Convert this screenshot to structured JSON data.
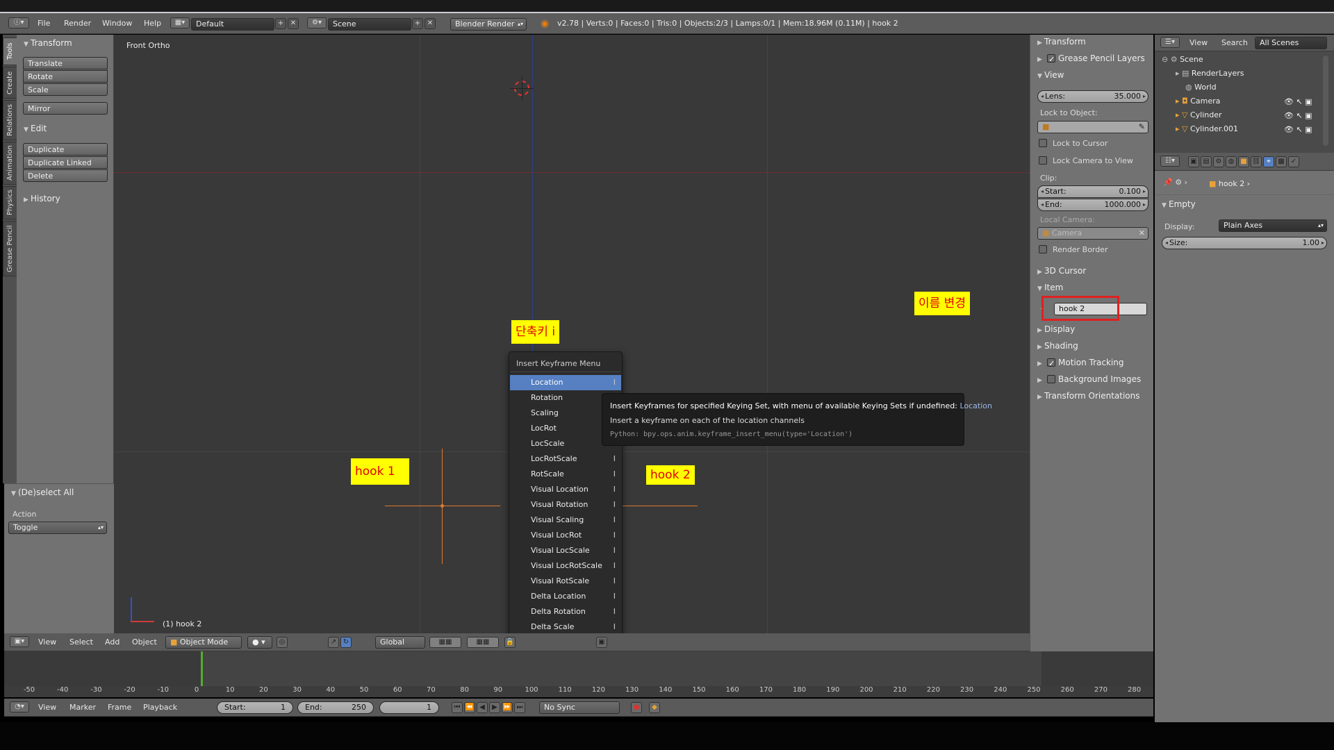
{
  "colors": {
    "accent_blue": "#5680c2",
    "annotation_bg": "#ffff00",
    "annotation_text": "#e00000",
    "viewport_bg": "#393939",
    "panel_bg": "#727272",
    "selection_orange": "#e07a30"
  },
  "top": {
    "menus": [
      "File",
      "Render",
      "Window",
      "Help"
    ],
    "layout": "Default",
    "scene": "Scene",
    "engine": "Blender Render",
    "stats": "v2.78 | Verts:0 | Faces:0 | Tris:0 | Objects:2/3 | Lamps:0/1 | Mem:18.96M (0.11M) | hook 2"
  },
  "tool_tabs": [
    "Tools",
    "Create",
    "Relations",
    "Animation",
    "Physics",
    "Grease Pencil"
  ],
  "toolshelf": {
    "transform_title": "Transform",
    "transform_buttons": [
      "Translate",
      "Rotate",
      "Scale"
    ],
    "mirror": "Mirror",
    "edit_title": "Edit",
    "edit_buttons": [
      "Duplicate",
      "Duplicate Linked",
      "Delete"
    ],
    "history": "History",
    "operator_title": "(De)select All",
    "action_label": "Action",
    "action_value": "Toggle"
  },
  "viewport": {
    "view_name": "Front Ortho",
    "object_label": "(1) hook 2",
    "annotations": {
      "shortcut": "단축키 i",
      "hook1": "hook 1",
      "hook2": "hook 2",
      "rename": "이름 변경"
    }
  },
  "keyframe_menu": {
    "title": "Insert Keyframe Menu",
    "items": [
      "Location",
      "Rotation",
      "Scaling",
      "LocRot",
      "LocScale",
      "LocRotScale",
      "RotScale",
      "Visual Location",
      "Visual Rotation",
      "Visual Scaling",
      "Visual LocRot",
      "Visual LocScale",
      "Visual LocRotScale",
      "Visual RotScale",
      "Delta Location",
      "Delta Rotation",
      "Delta Scale"
    ],
    "shortcut": "I",
    "tooltip": {
      "line1": "Insert Keyframes for specified Keying Set, with menu of available Keying Sets if undefined:",
      "line1_value": "Location",
      "line2": "Insert a keyframe on each of the location channels",
      "python": "Python: bpy.ops.anim.keyframe_insert_menu(type='Location')"
    }
  },
  "viewport_header": {
    "menus": [
      "View",
      "Select",
      "Add",
      "Object"
    ],
    "mode": "Object Mode",
    "orientation": "Global"
  },
  "properties_panel": {
    "transform": "Transform",
    "grease_pencil_layers": "Grease Pencil Layers",
    "view": "View",
    "lens_label": "Lens:",
    "lens_value": "35.000",
    "lock_to_object": "Lock to Object:",
    "lock_to_cursor": "Lock to Cursor",
    "lock_camera": "Lock Camera to View",
    "clip": "Clip:",
    "clip_start_label": "Start:",
    "clip_start": "0.100",
    "clip_end_label": "End:",
    "clip_end": "1000.000",
    "local_camera": "Local Camera:",
    "local_camera_value": "Camera",
    "render_border": "Render Border",
    "cursor_3d": "3D Cursor",
    "item": "Item",
    "item_name": "hook 2",
    "display": "Display",
    "shading": "Shading",
    "motion_tracking": "Motion Tracking",
    "background_images": "Background Images",
    "transform_orientations": "Transform Orientations"
  },
  "outliner": {
    "menus": [
      "View",
      "Search"
    ],
    "filter": "All Scenes",
    "rows": [
      "Scene",
      "RenderLayers",
      "World",
      "Camera",
      "Cylinder",
      "Cylinder.001"
    ]
  },
  "props_editor": {
    "breadcrumb": "hook 2",
    "panel": "Empty",
    "display_label": "Display:",
    "display_value": "Plain Axes",
    "size_label": "Size:",
    "size_value": "1.00"
  },
  "timeline": {
    "ruler": [
      "-50",
      "-40",
      "-30",
      "-20",
      "-10",
      "0",
      "10",
      "20",
      "30",
      "40",
      "50",
      "60",
      "70",
      "80",
      "90",
      "100",
      "110",
      "120",
      "130",
      "140",
      "150",
      "160",
      "170",
      "180",
      "190",
      "200",
      "210",
      "220",
      "230",
      "240",
      "250",
      "260",
      "270",
      "280"
    ],
    "menus": [
      "View",
      "Marker",
      "Frame",
      "Playback"
    ],
    "start_label": "Start:",
    "start": "1",
    "end_label": "End:",
    "end": "250",
    "current": "1",
    "sync": "No Sync"
  }
}
